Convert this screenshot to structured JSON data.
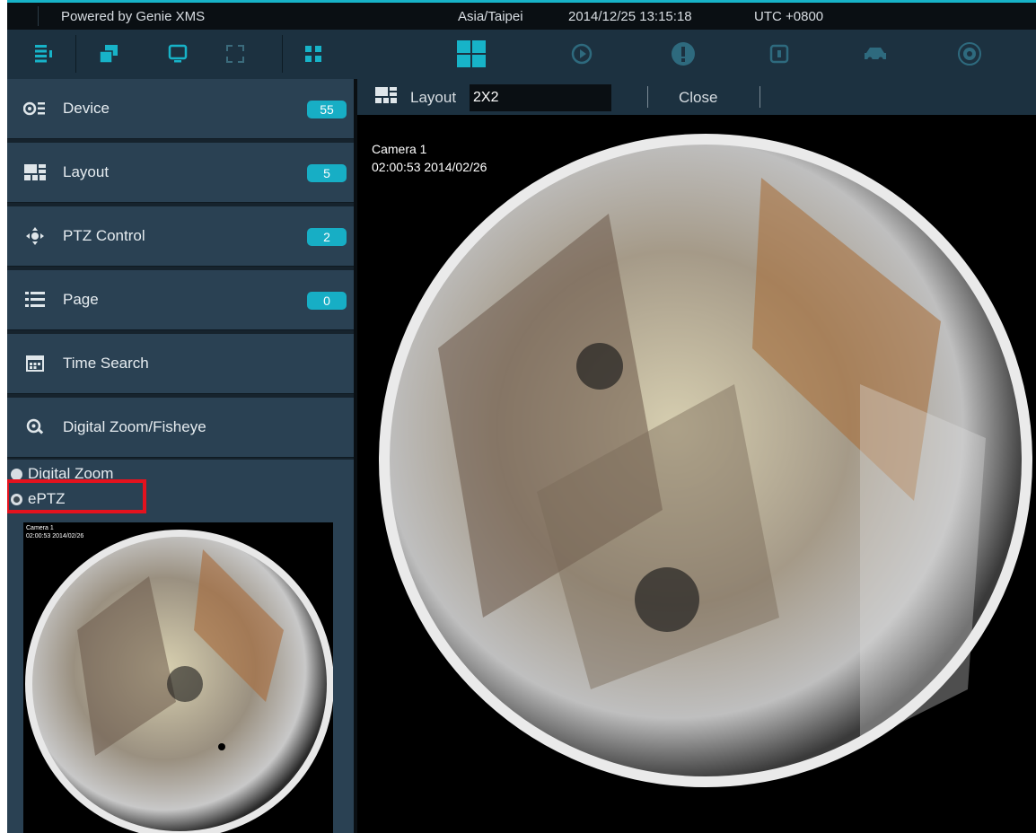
{
  "statusbar": {
    "brand": "Powered by Genie XMS",
    "timezone": "Asia/Taipei",
    "datetime": "2014/12/25 13:15:18",
    "utc": "UTC +0800"
  },
  "toolbar": {
    "left_icons": [
      "menu-collapse-icon",
      "window-stack-icon",
      "monitor-icon",
      "fullscreen-icon",
      "grid-split-icon"
    ],
    "center_icons": [
      "layout-grid-icon",
      "playback-icon",
      "alert-icon",
      "lock-icon",
      "car-icon",
      "settings-gear-icon"
    ],
    "accent": "#17b3c8"
  },
  "sidebar": {
    "items": [
      {
        "icon": "device-icon",
        "label": "Device",
        "count": "55"
      },
      {
        "icon": "layout-icon",
        "label": "Layout",
        "count": "5"
      },
      {
        "icon": "ptz-icon",
        "label": "PTZ Control",
        "count": "2"
      },
      {
        "icon": "page-icon",
        "label": "Page",
        "count": "0"
      },
      {
        "icon": "calendar-icon",
        "label": "Time Search"
      },
      {
        "icon": "zoom-icon",
        "label": "Digital Zoom/Fisheye"
      }
    ],
    "zoom_options": [
      {
        "label": "Digital Zoom",
        "selected": false
      },
      {
        "label": "ePTZ",
        "selected": true
      }
    ],
    "preview": {
      "camera": "Camera 1",
      "timestamp": "02:00:53  2014/02/26"
    },
    "highlight_color": "#e4121e"
  },
  "main": {
    "layout_label": "Layout",
    "layout_value": "2X2",
    "close_label": "Close",
    "camera": "Camera 1",
    "timestamp": "02:00:53  2014/02/26"
  }
}
